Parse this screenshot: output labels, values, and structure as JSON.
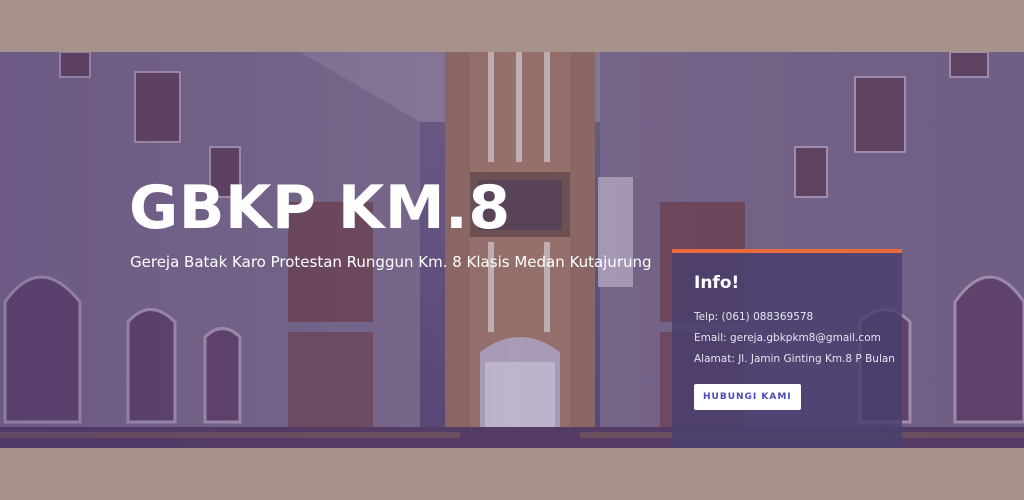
{
  "hero": {
    "title": "GBKP KM.8",
    "subtitle": "Gereja Batak Karo Protestan Runggun Km. 8 Klasis Medan Kutajurung"
  },
  "info": {
    "heading": "Info!",
    "phone": "Telp: (061) 088369578",
    "email": "Email: gereja.gbkpkm8@gmail.com",
    "address": "Alamat: Jl. Jamin Ginting Km.8 P Bulan",
    "button_label": "HUBUNGI KAMI"
  },
  "colors": {
    "page_background": "#a6928a",
    "card_accent": "#e8693a",
    "button_text": "#4a4ab8"
  }
}
